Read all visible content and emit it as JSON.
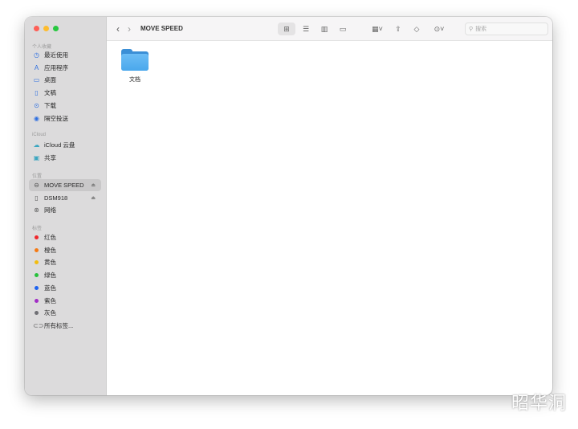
{
  "window": {
    "title": "MOVE SPEED"
  },
  "sidebar": {
    "favorites_header": "个人收藏",
    "favorites": [
      {
        "label": "最近使用",
        "icon": "clock-icon"
      },
      {
        "label": "应用程序",
        "icon": "apps-icon"
      },
      {
        "label": "桌面",
        "icon": "desktop-icon"
      },
      {
        "label": "文稿",
        "icon": "document-icon"
      },
      {
        "label": "下载",
        "icon": "download-icon"
      },
      {
        "label": "隔空投送",
        "icon": "airdrop-icon"
      }
    ],
    "icloud_header": "iCloud",
    "icloud": [
      {
        "label": "iCloud 云盘",
        "icon": "cloud-icon"
      },
      {
        "label": "共享",
        "icon": "shared-folder-icon"
      }
    ],
    "locations_header": "位置",
    "locations": [
      {
        "label": "MOVE SPEED",
        "icon": "drive-icon",
        "selected": true
      },
      {
        "label": "DSM918",
        "icon": "file-icon"
      },
      {
        "label": "网络",
        "icon": "network-icon"
      }
    ],
    "tags_header": "标签",
    "tags": [
      {
        "label": "红色",
        "color": "#f0262b"
      },
      {
        "label": "橙色",
        "color": "#f57a14"
      },
      {
        "label": "黄色",
        "color": "#f2bd0f"
      },
      {
        "label": "绿色",
        "color": "#27c13b"
      },
      {
        "label": "蓝色",
        "color": "#1e63f0"
      },
      {
        "label": "紫色",
        "color": "#a22ec6"
      },
      {
        "label": "灰色",
        "color": "#707075"
      }
    ],
    "all_tags": "所有标签..."
  },
  "toolbar": {
    "search_placeholder": "搜索"
  },
  "content": {
    "items": [
      {
        "label": "文档",
        "icon": "folder-icon"
      }
    ]
  },
  "watermark": "昭华洞"
}
